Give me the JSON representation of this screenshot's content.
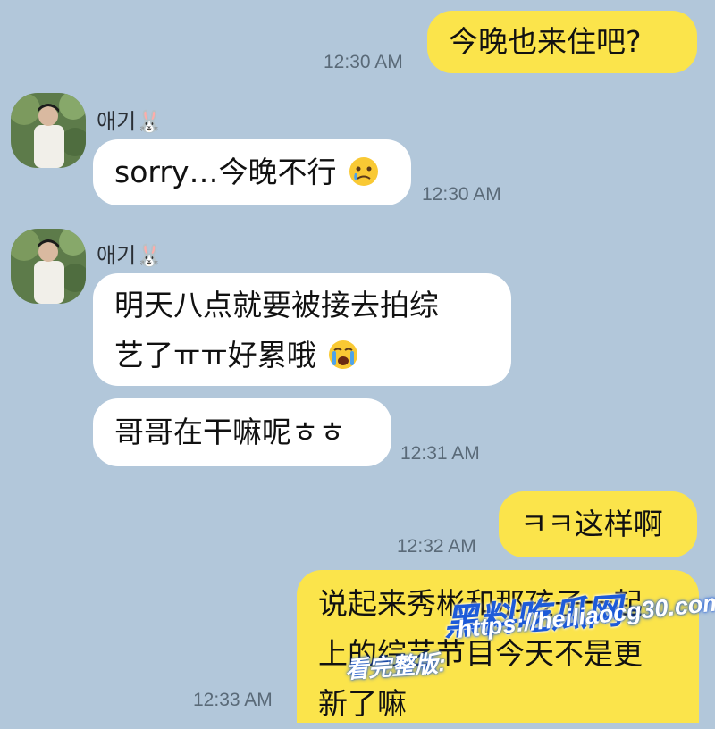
{
  "messages": [
    {
      "side": "mine",
      "text": "今晚也来住吧?",
      "time": "12:30 AM"
    },
    {
      "side": "theirs",
      "sender": "애기🐰",
      "text": "sorry…今晚不行",
      "emoji": "sad-tear-emoji",
      "time": "12:30 AM"
    },
    {
      "side": "theirs",
      "sender": "애기🐰",
      "text_line1": "明天八点就要被接去拍综",
      "text_line2": "艺了ㅠㅠ好累哦",
      "emoji": "crying-emoji"
    },
    {
      "side": "theirs",
      "text": "哥哥在干嘛呢ㅎㅎ",
      "time": "12:31 AM"
    },
    {
      "side": "mine",
      "text": "ㅋㅋ这样啊",
      "time": "12:32 AM"
    },
    {
      "side": "mine",
      "text_line1": "说起来秀彬和那孩子一起",
      "text_line2": "上的综艺节目今天不是更",
      "text_line3": "新了嘛",
      "time": "12:33 AM"
    }
  ],
  "watermark": {
    "brand": "黑料吃瓜网",
    "label": "看完整版:",
    "url": "https://heiliaocg30.com"
  },
  "colors": {
    "background": "#b2c7da",
    "mine_bubble": "#fbe44b",
    "theirs_bubble": "#ffffff",
    "watermark_blue": "#1e5bd8"
  }
}
